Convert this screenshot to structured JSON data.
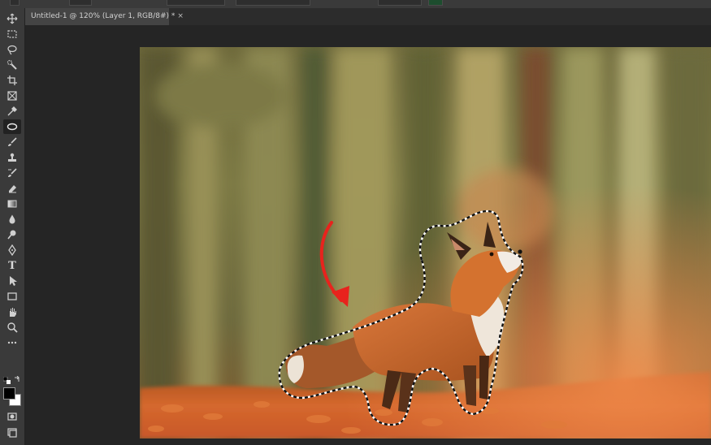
{
  "document": {
    "tab_title": "Untitled-1 @ 120% (Layer 1, RGB/8#) *",
    "tab_close": "×"
  },
  "colors": {
    "ui_panel": "#3a3a3a",
    "canvas_bg": "#252525",
    "arrow": "#e8231d",
    "foreground_swatch": "#000000",
    "background_swatch": "#ffffff"
  },
  "tools": [
    {
      "name": "move-tool",
      "icon": "move-icon"
    },
    {
      "name": "marquee-tool",
      "icon": "rectangle-marquee-icon"
    },
    {
      "name": "lasso-tool",
      "icon": "lasso-icon"
    },
    {
      "name": "quick-selection-tool",
      "icon": "quick-selection-icon"
    },
    {
      "name": "crop-tool",
      "icon": "crop-icon"
    },
    {
      "name": "frame-tool",
      "icon": "frame-icon"
    },
    {
      "name": "eyedropper-tool",
      "icon": "eyedropper-icon"
    },
    {
      "name": "spot-healing-tool",
      "icon": "healing-icon",
      "active": true
    },
    {
      "name": "brush-tool",
      "icon": "brush-icon"
    },
    {
      "name": "clone-stamp-tool",
      "icon": "stamp-icon"
    },
    {
      "name": "history-brush-tool",
      "icon": "history-brush-icon"
    },
    {
      "name": "eraser-tool",
      "icon": "eraser-icon"
    },
    {
      "name": "gradient-tool",
      "icon": "gradient-icon"
    },
    {
      "name": "blur-tool",
      "icon": "blur-drop-icon"
    },
    {
      "name": "dodge-tool",
      "icon": "dodge-icon"
    },
    {
      "name": "pen-tool",
      "icon": "pen-icon"
    },
    {
      "name": "type-tool",
      "icon": "type-icon"
    },
    {
      "name": "path-selection-tool",
      "icon": "path-selection-icon"
    },
    {
      "name": "rectangle-tool",
      "icon": "rectangle-shape-icon"
    },
    {
      "name": "hand-tool",
      "icon": "hand-icon"
    },
    {
      "name": "zoom-tool",
      "icon": "zoom-icon"
    },
    {
      "name": "more-tools",
      "icon": "ellipsis-icon"
    }
  ],
  "type_tool_glyph": "T"
}
